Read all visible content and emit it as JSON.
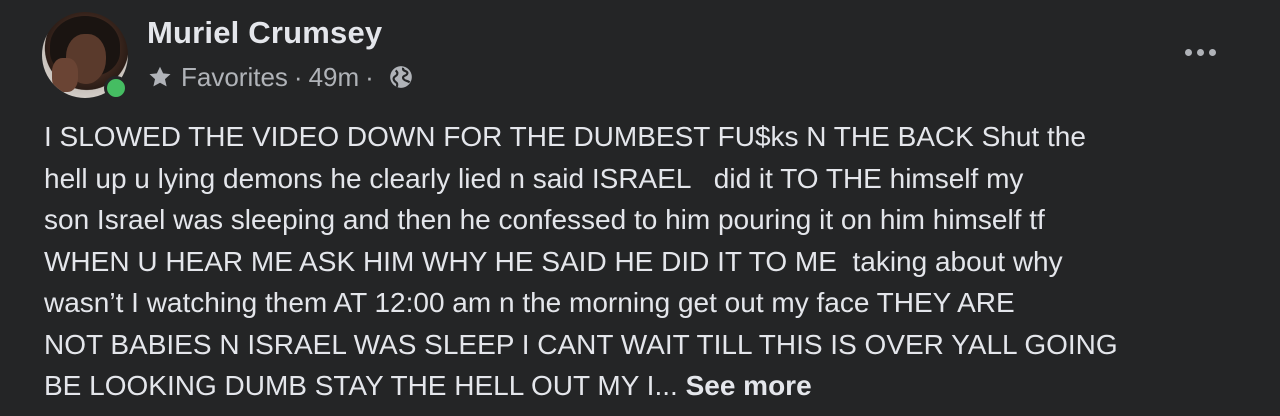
{
  "post": {
    "author": {
      "name": "Muriel Crumsey",
      "avatar_icon": "profile-photo",
      "online": true,
      "online_color": "#45bd62"
    },
    "meta": {
      "audience_label": "Favorites",
      "audience_icon": "star-icon",
      "separator": "·",
      "timestamp": "49m",
      "privacy_icon": "globe-icon"
    },
    "more_options_icon": "ellipsis-icon",
    "body": {
      "lines": [
        "I SLOWED THE VIDEO DOWN FOR THE DUMBEST FU$ks N THE BACK Shut the",
        "hell up u lying demons he clearly lied n said ISRAEL   did it TO THE himself my",
        "son Israel was sleeping and then he confessed to him pouring it on him himself tf",
        "WHEN U HEAR ME ASK HIM WHY HE SAID HE DID IT TO ME  taking about why",
        "wasn’t I watching them AT 12:00 am n the morning get out my face THEY ARE",
        "NOT BABIES N ISRAEL WAS SLEEP I CANT WAIT TILL THIS IS OVER YALL GOING",
        "BE LOOKING DUMB STAY THE HELL OUT MY I..."
      ],
      "see_more_label": "See more"
    }
  },
  "colors": {
    "background": "#242526",
    "primary_text": "#e4e6eb",
    "secondary_text": "#b0b3b8"
  }
}
